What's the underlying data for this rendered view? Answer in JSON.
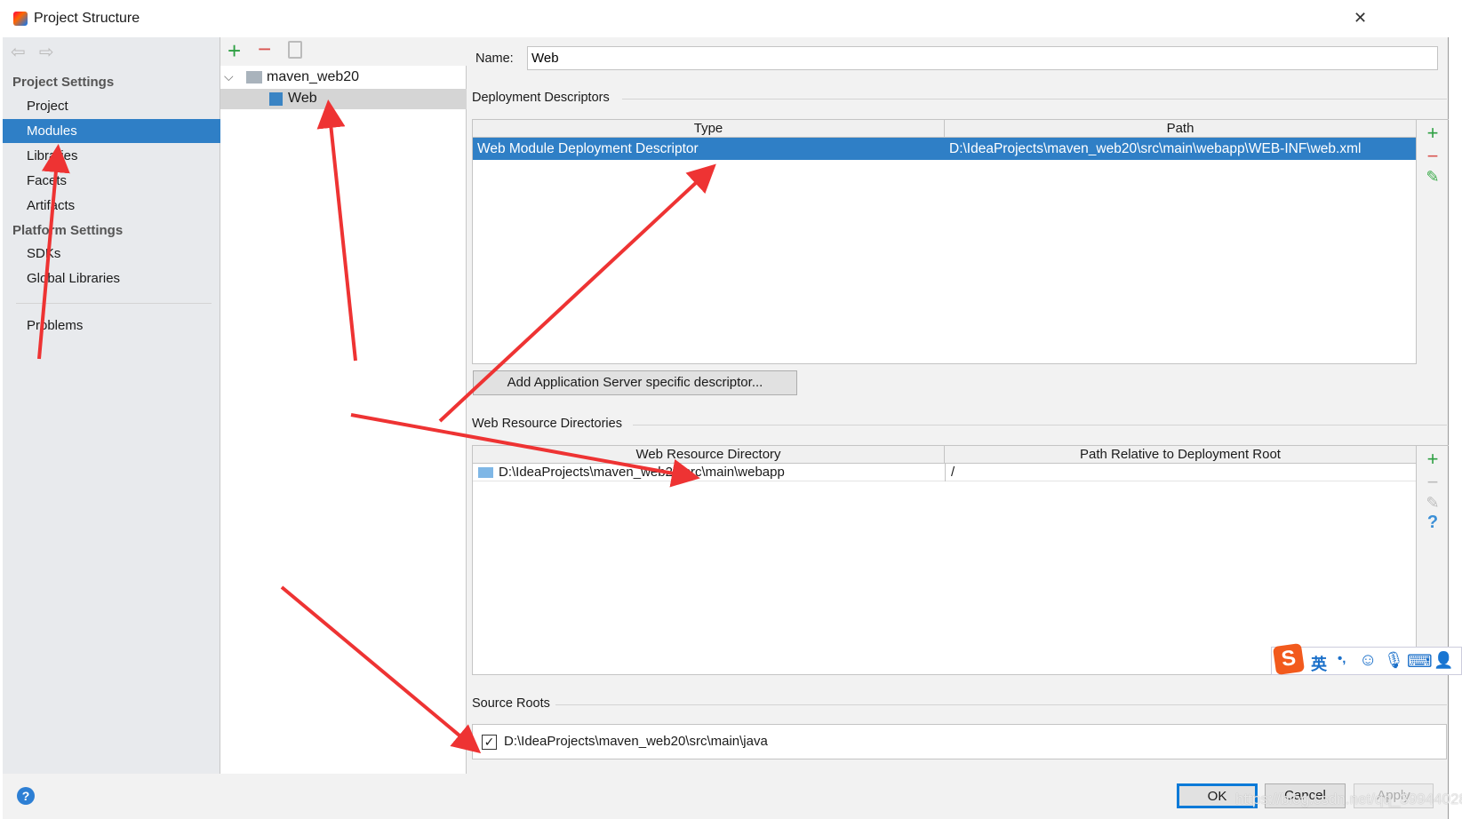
{
  "window": {
    "title": "Project Structure",
    "close": "✕"
  },
  "sidebar": {
    "project_settings": "Project Settings",
    "items": [
      {
        "label": "Project"
      },
      {
        "label": "Modules",
        "selected": true
      },
      {
        "label": "Libraries"
      },
      {
        "label": "Facets"
      },
      {
        "label": "Artifacts"
      }
    ],
    "platform_settings": "Platform Settings",
    "platform_items": [
      {
        "label": "SDKs"
      },
      {
        "label": "Global Libraries"
      }
    ],
    "problems": "Problems"
  },
  "tree": {
    "root": "maven_web20",
    "child": "Web"
  },
  "form": {
    "name_label": "Name:",
    "name_value": "Web",
    "deployment_title": "Deployment Descriptors",
    "deployment_columns": [
      "Type",
      "Path"
    ],
    "deployment_rows": [
      {
        "type": "Web Module Deployment Descriptor",
        "path": "D:\\IdeaProjects\\maven_web20\\src\\main\\webapp\\WEB-INF\\web.xml"
      }
    ],
    "add_descriptor_button": "Add Application Server specific descriptor...",
    "resources_title": "Web Resource Directories",
    "resources_columns": [
      "Web Resource Directory",
      "Path Relative to Deployment Root"
    ],
    "resources_rows": [
      {
        "dir": "D:\\IdeaProjects\\maven_web20\\src\\main\\webapp",
        "rel": "/"
      }
    ],
    "source_title": "Source Roots",
    "source_roots": [
      {
        "path": "D:\\IdeaProjects\\maven_web20\\src\\main\\java",
        "checked": true
      }
    ]
  },
  "buttons": {
    "ok": "OK",
    "cancel": "Cancel",
    "apply": "Apply",
    "help": "?"
  },
  "ime": {
    "lang": "英",
    "punct": "•,"
  },
  "watermark": "https://blog.csdn.net/qq_39944028",
  "colors": {
    "selection": "#2f7fc6",
    "add": "#2ea043",
    "remove": "#d9534f",
    "arrow": "#ee3333"
  }
}
